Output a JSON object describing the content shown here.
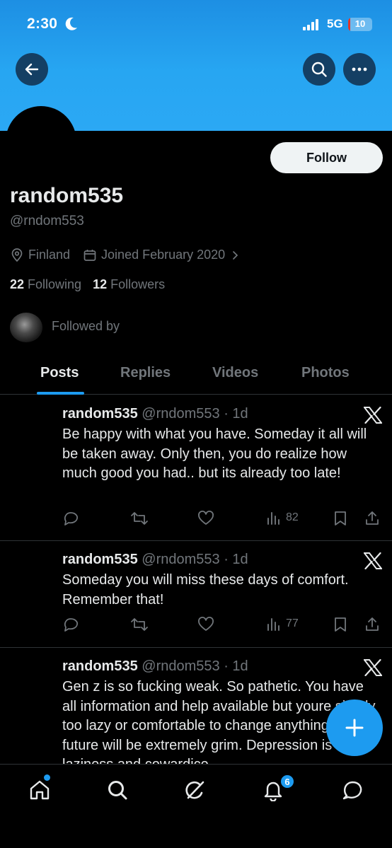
{
  "status_bar": {
    "time": "2:30",
    "network": "5G",
    "battery": "10",
    "battery_level": 0.1
  },
  "profile": {
    "display_name": "random535",
    "handle": "@rndom553",
    "location": "Finland",
    "joined": "Joined February 2020",
    "following_count": "22",
    "following_label": "Following",
    "followers_count": "12",
    "followers_label": "Followers",
    "followed_by": "Followed by",
    "follow_label": "Follow"
  },
  "tabs": [
    {
      "label": "Posts",
      "active": true
    },
    {
      "label": "Replies",
      "active": false
    },
    {
      "label": "Videos",
      "active": false
    },
    {
      "label": "Photos",
      "active": false
    }
  ],
  "posts": [
    {
      "name": "random535",
      "handle": "@rndom553",
      "time": "· 1d",
      "text": "Be happy with what you have. Someday it all will be taken away. Only then, you do realize how much good you had.. but its already too late!",
      "views": "82"
    },
    {
      "name": "random535",
      "handle": "@rndom553",
      "time": "· 1d",
      "text": "Someday you will miss these days of comfort. Remember that!",
      "views": "77"
    },
    {
      "name": "random535",
      "handle": "@rndom553",
      "time": "· 1d",
      "text": "Gen z is so fucking weak. So pathetic. You have all information and help available but youre simply too lazy or comfortable to change anything. Your future will be extremely grim. Depression is laziness and cowardice."
    }
  ],
  "bottom_nav": {
    "notification_count": "6"
  },
  "colors": {
    "accent": "#1d9bf0",
    "banner": "#2ba8f4",
    "background": "#000000",
    "secondary_text": "#71767b"
  }
}
